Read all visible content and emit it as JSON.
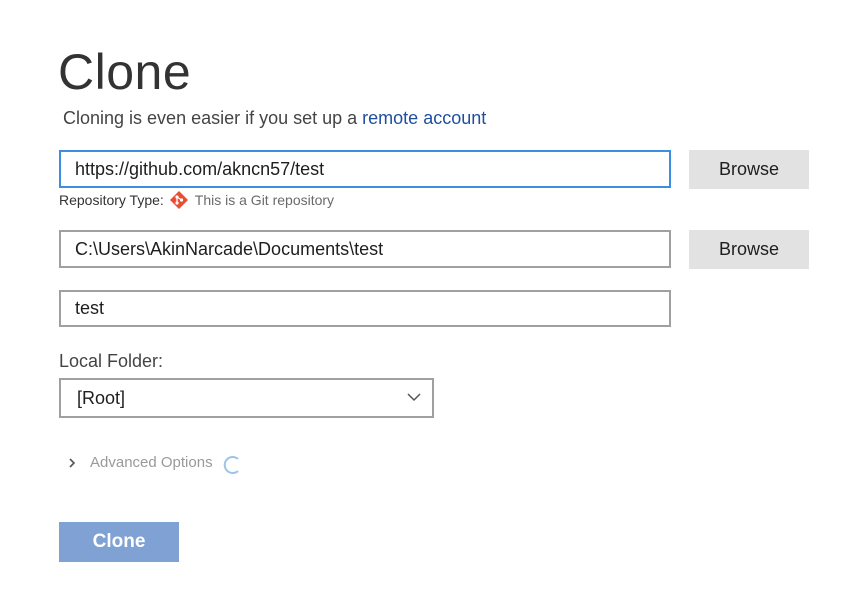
{
  "header": {
    "title": "Clone",
    "subtitle_prefix": "Cloning is even easier if you set up a ",
    "subtitle_link": "remote account"
  },
  "repository": {
    "url_value": "https://github.com/akncn57/test",
    "browse_label": "Browse",
    "type_label": "Repository Type:",
    "type_note": "This is a Git repository",
    "type_icon": "git-icon"
  },
  "local_path": {
    "value": "C:\\Users\\AkinNarcade\\Documents\\test",
    "browse_label": "Browse"
  },
  "name_field": {
    "value": "test"
  },
  "local_folder": {
    "label": "Local Folder:",
    "selected": "[Root]"
  },
  "advanced": {
    "label": "Advanced Options"
  },
  "actions": {
    "clone_label": "Clone"
  },
  "colors": {
    "link": "#1e4e9e",
    "focus_border": "#3c8ee0",
    "primary_button": "#7fa1d3",
    "git_icon": "#e94e31"
  }
}
